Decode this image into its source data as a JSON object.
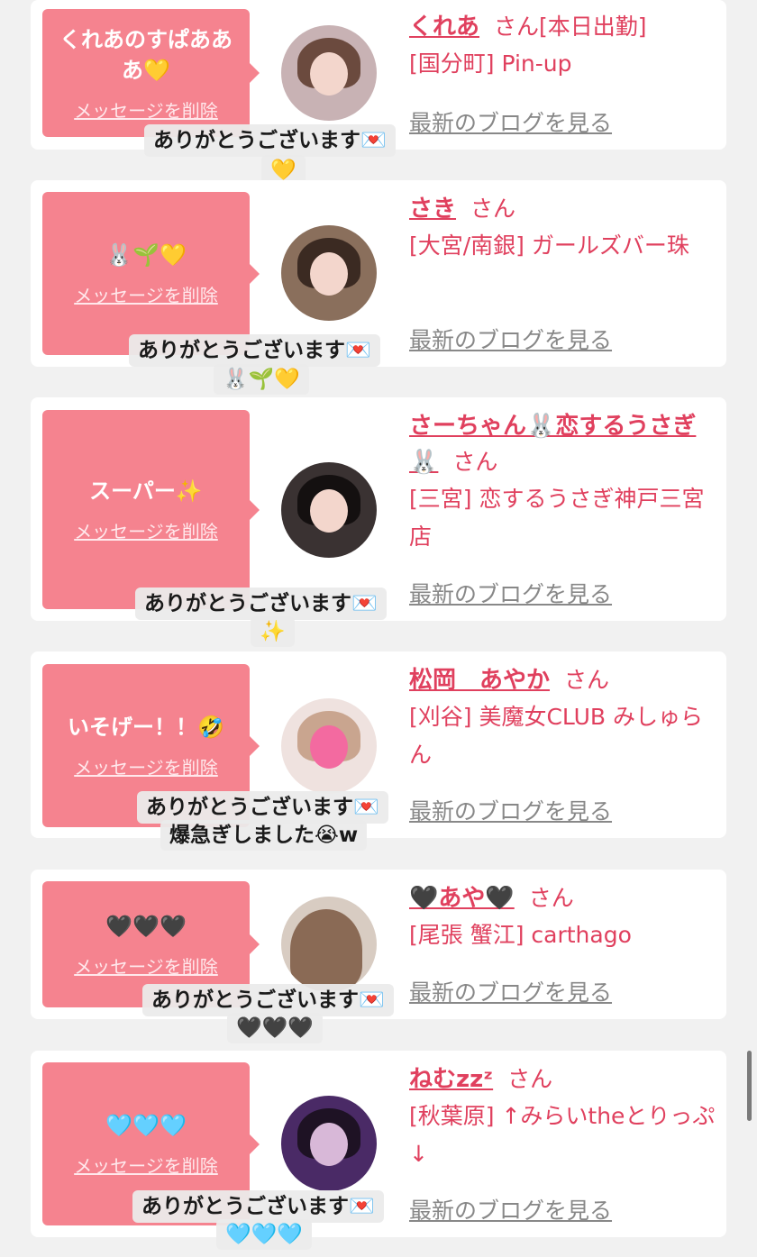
{
  "delete_label": "メッセージを削除",
  "blog_label": "最新のブログを見る",
  "san_label": "さん",
  "colors": {
    "bubble": "#f5838f",
    "name": "#e0405e",
    "link_gray": "#888888",
    "page_bg": "#f1f1f1"
  },
  "cards": [
    {
      "bubble_message": "くれあのすぱあああ💛",
      "name": "くれあ",
      "suffix": "[本日出勤]",
      "shop": "[国分町] Pin-up",
      "reply_line1": "ありがとうございます💌",
      "reply_line2": "💛",
      "avatar": "girl-with-glasses-photo"
    },
    {
      "bubble_message": "🐰🌱💛",
      "name": "さき",
      "suffix": "",
      "shop": "[大宮/南銀] ガールズバー珠",
      "reply_line1": "ありがとうございます💌",
      "reply_line2": "🐰🌱💛",
      "avatar": "girl-in-cafe-photo"
    },
    {
      "bubble_message": "スーパー✨",
      "name": "さーちゃん🐰恋するうさぎ🐰",
      "suffix": "",
      "shop": "[三宮] 恋するうさぎ神戸三宮店",
      "reply_line1": "ありがとうございます💌",
      "reply_line2": "✨",
      "avatar": "girl-black-hair-photo"
    },
    {
      "bubble_message": "いそげー！！🤣",
      "name": "松岡　あやか",
      "suffix": "",
      "shop": "[刈谷] 美魔女CLUB みしゅらん",
      "reply_line1": "ありがとうございます💌",
      "reply_line2": "爆急ぎしました😭w",
      "avatar": "girl-with-heart-sticker-photo"
    },
    {
      "bubble_message": "🖤🖤🖤",
      "name": "🖤あや🖤",
      "suffix": "",
      "shop": "[尾張 蟹江] carthago",
      "reply_line1": "ありがとうございます💌",
      "reply_line2": "🖤🖤🖤",
      "avatar": "girl-long-hair-back-photo"
    },
    {
      "bubble_message": "🩵🩵🩵",
      "name": "ねむzzᶻ",
      "suffix": "",
      "shop": "[秋葉原] ↑みらいtheとりっぷ↓",
      "reply_line1": "ありがとうございます💌",
      "reply_line2": "🩵🩵🩵",
      "avatar": "girl-purple-light-photo"
    }
  ]
}
